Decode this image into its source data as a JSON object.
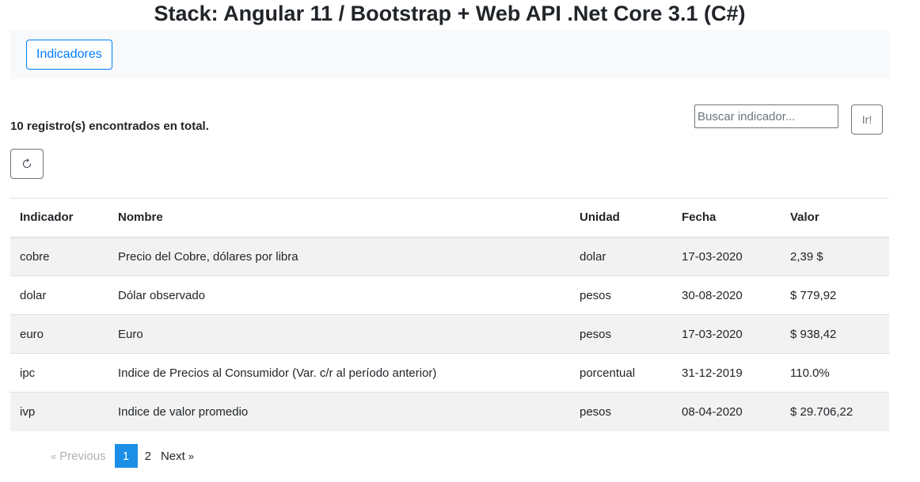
{
  "header": {
    "title": "Stack: Angular 11 / Bootstrap + Web API .Net Core 3.1 (C#)"
  },
  "navbar": {
    "button_label": "Indicadores"
  },
  "toolbar": {
    "records_text": "10 registro(s) encontrados en total.",
    "search_placeholder": "Buscar indicador...",
    "search_value": "",
    "go_label": "Ir!",
    "refresh_icon": "refresh-icon"
  },
  "table": {
    "columns": [
      "Indicador",
      "Nombre",
      "Unidad",
      "Fecha",
      "Valor"
    ],
    "rows": [
      [
        "cobre",
        "Precio del Cobre, dólares por libra",
        "dolar",
        "17-03-2020",
        "2,39 $"
      ],
      [
        "dolar",
        "Dólar observado",
        "pesos",
        "30-08-2020",
        "$ 779,92"
      ],
      [
        "euro",
        "Euro",
        "pesos",
        "17-03-2020",
        "$ 938,42"
      ],
      [
        "ipc",
        "Indice de Precios al Consumidor (Var. c/r al período anterior)",
        "porcentual",
        "31-12-2019",
        "110.0%"
      ],
      [
        "ivp",
        "Indice de valor promedio",
        "pesos",
        "08-04-2020",
        "$ 29.706,22"
      ]
    ]
  },
  "pagination": {
    "prev_arrow": "«",
    "prev_label": "Previous",
    "pages": [
      "1",
      "2"
    ],
    "active_page": "1",
    "next_label": "Next",
    "next_arrow": "»"
  },
  "colors": {
    "primary": "#007bff",
    "active_page": "#1b8ee6",
    "navbar_bg": "#f8f9fa",
    "striped_row": "#f2f2f2"
  }
}
